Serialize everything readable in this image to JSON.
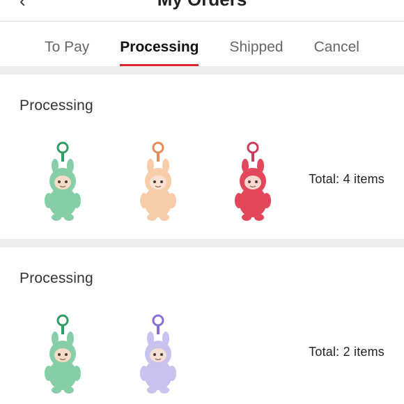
{
  "header": {
    "title": "My Orders"
  },
  "tabs": [
    {
      "label": "To Pay",
      "active": false
    },
    {
      "label": "Processing",
      "active": true
    },
    {
      "label": "Shipped",
      "active": false
    },
    {
      "label": "Cancel",
      "active": false
    }
  ],
  "orders": [
    {
      "status": "Processing",
      "total": "Total: 4 items",
      "items": [
        {
          "icon": "green-plush-toy-icon",
          "body": "#86cfa6",
          "face": "#f6dcc6",
          "ring": "#2e9c64"
        },
        {
          "icon": "peach-plush-toy-icon",
          "body": "#f7cdaa",
          "face": "#f9e3d3",
          "ring": "#e88a5a"
        },
        {
          "icon": "red-plush-toy-icon",
          "body": "#e2475c",
          "face": "#f8d7cd",
          "ring": "#d23a5b"
        }
      ]
    },
    {
      "status": "Processing",
      "total": "Total: 2 items",
      "items": [
        {
          "icon": "green-plush-toy-icon",
          "body": "#86cfa6",
          "face": "#f6dcc6",
          "ring": "#2e9c64"
        },
        {
          "icon": "lavender-plush-toy-icon",
          "body": "#c9c1ee",
          "face": "#f6dfd3",
          "ring": "#8a6ed8"
        }
      ]
    }
  ]
}
